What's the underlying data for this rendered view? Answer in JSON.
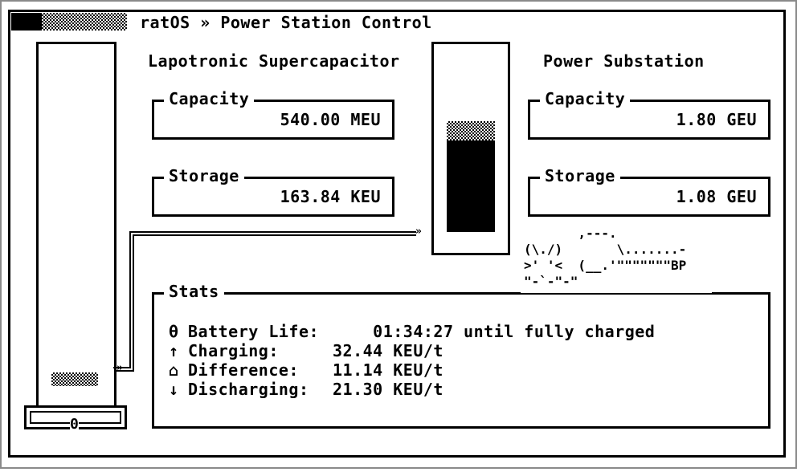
{
  "window": {
    "title": "ratOS » Power Station Control"
  },
  "supercapacitor": {
    "heading": "Lapotronic Supercapacitor",
    "capacity_label": "Capacity",
    "capacity_value": "540.00 MEU",
    "storage_label": "Storage",
    "storage_value": "163.84 KEU",
    "fill_fraction": 0.04
  },
  "substation": {
    "heading": "Power Substation",
    "capacity_label": "Capacity",
    "capacity_value": "1.80 GEU",
    "storage_label": "Storage",
    "storage_value": "1.08 GEU",
    "fill_fraction": 0.6
  },
  "connector_marker": "0",
  "pipe_arrow_right": "»",
  "pipe_arrow_left": "»",
  "ascii_art": {
    "line1": "       ,---.",
    "line2": "(\\./)       \\.......-",
    "line3": ">' '<  (__.'\"\"\"\"\"\"\"BP",
    "line4": "\"-`-\"-\""
  },
  "stats": {
    "legend": "Stats",
    "rows": [
      {
        "icon": "θ",
        "icon_name": "battery-life-icon",
        "label": "Battery Life:",
        "value": "    01:34:27 until fully charged"
      },
      {
        "icon": "↑",
        "icon_name": "charging-arrow-icon",
        "label": "Charging:",
        "value": "32.44 KEU/t"
      },
      {
        "icon": "⌂",
        "icon_name": "difference-icon",
        "label": "Difference:",
        "value": "11.14 KEU/t"
      },
      {
        "icon": "↓",
        "icon_name": "discharging-arrow-icon",
        "label": "Discharging:",
        "value": "21.30 KEU/t"
      }
    ]
  }
}
